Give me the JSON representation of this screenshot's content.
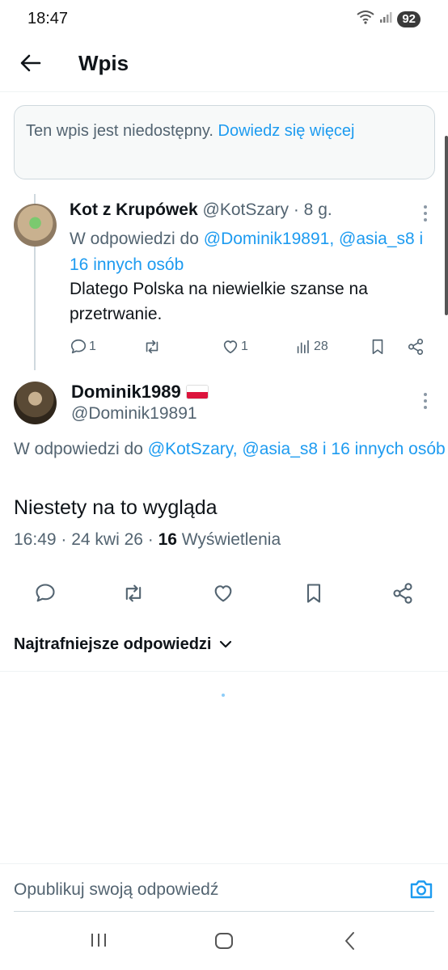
{
  "status_bar": {
    "time": "18:47",
    "battery": "92"
  },
  "header": {
    "title": "Wpis"
  },
  "notice": {
    "text": "Ten wpis jest niedostępny. ",
    "link": "Dowiedz się więcej"
  },
  "reply_post": {
    "author_name": "Kot z Krupówek",
    "meta": " @KotSzary · 8 g.",
    "reply_to_prefix": "W odpowiedzi do ",
    "reply_to_links": "@Dominik19891, @asia_s8 i 16 innych osób",
    "text": "Dlatego Polska na niewielkie szanse na przetrwanie.",
    "replies": "1",
    "likes": "1",
    "views": "28"
  },
  "main_post": {
    "author_name": "Dominik1989",
    "handle": "@Dominik19891",
    "reply_to_prefix": "W odpowiedzi do ",
    "reply_to_links": "@KotSzary, @asia_s8 i 16 innych osób",
    "text": "Niestety na to wygląda",
    "time_date": "16:49 · 24 kwi 26 · ",
    "views_count": "16",
    "views_label": " Wyświetlenia",
    "flag_colors": [
      "#ffffff",
      "#dc143c"
    ]
  },
  "sort": {
    "label": "Najtrafniejsze odpowiedzi"
  },
  "compose": {
    "placeholder": "Opublikuj swoją odpowiedź"
  },
  "colors": {
    "accent": "#1d9bf0",
    "secondary_text": "#536471",
    "primary_text": "#0f1419"
  }
}
